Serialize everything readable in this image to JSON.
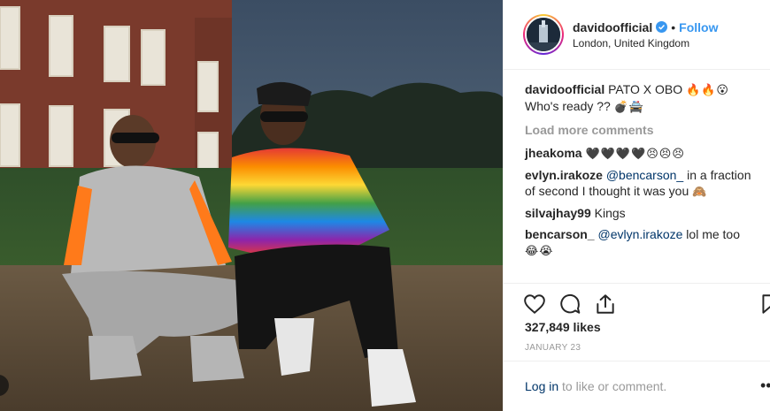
{
  "post": {
    "username": "davidoofficial",
    "follow_label": "Follow",
    "dot": "•",
    "location": "London, United Kingdom"
  },
  "caption": {
    "username": "davidoofficial",
    "text": "PATO X OBO",
    "emojis": "🔥🔥😮",
    "text2": "Who's ready ??",
    "emojis2": "💣🚔"
  },
  "load_more_label": "Load more comments",
  "comments": [
    {
      "username": "jheakoma",
      "text": "",
      "emojis": "🖤🖤🖤🖤😣😣😣"
    },
    {
      "username": "evlyn.irakoze",
      "mention": "@bencarson_",
      "text": "in a fraction of second I thought it was you",
      "emojis": "🙈"
    },
    {
      "username": "silvajhay99",
      "text": "Kings",
      "emojis": ""
    },
    {
      "username": "bencarson_",
      "mention": "@evlyn.irakoze",
      "text": "lol me too",
      "emojis": "😂😭"
    }
  ],
  "likes": "327,849 likes",
  "date": "JANUARY 23",
  "login": {
    "link": "Log in",
    "text": "to like or comment."
  },
  "more_label": "•••",
  "icons": [
    "heart-icon",
    "comment-icon",
    "share-icon",
    "bookmark-icon",
    "verified-badge-icon"
  ],
  "colors": {
    "follow": "#3897f0",
    "mention": "#003569",
    "muted": "#999999"
  }
}
